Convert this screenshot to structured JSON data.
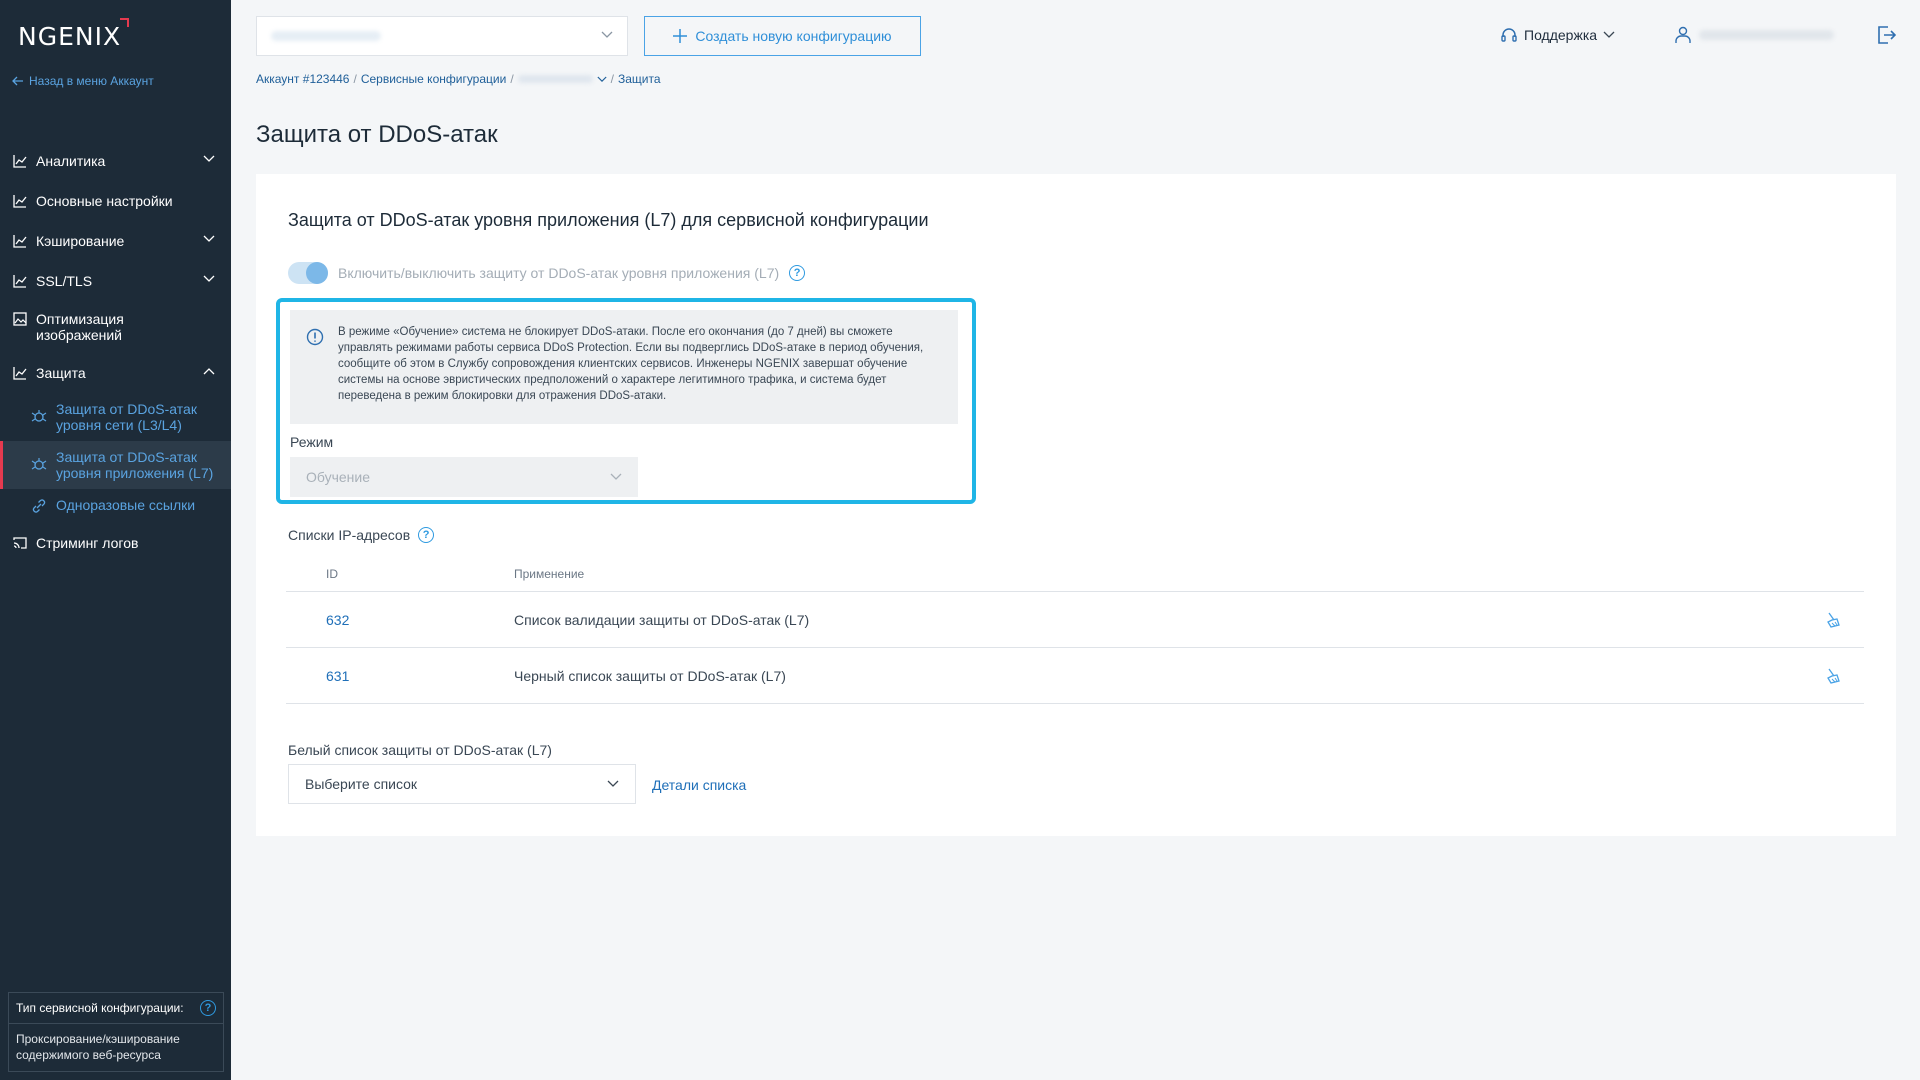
{
  "sidebar": {
    "logo": "NGENIX",
    "back_link": "Назад в меню Аккаунт",
    "items": [
      {
        "label": "Аналитика"
      },
      {
        "label": "Основные настройки"
      },
      {
        "label": "Кэширование"
      },
      {
        "label": "SSL/TLS"
      },
      {
        "label": "Оптимизация изображений"
      },
      {
        "label": "Защита"
      },
      {
        "label": "Стриминг логов"
      }
    ],
    "sub_items": [
      {
        "label": "Защита от DDoS-атак уровня сети (L3/L4)"
      },
      {
        "label": "Защита от DDoS-атак уровня приложения (L7)"
      },
      {
        "label": "Одноразовые ссылки"
      }
    ],
    "config_type": {
      "label": "Тип сервисной конфигурации:",
      "value": "Проксирование/кэширование содержимого веб-ресурса"
    }
  },
  "topbar": {
    "create_button": "Создать новую конфигурацию",
    "support": "Поддержка"
  },
  "breadcrumb": {
    "account": "Аккаунт #123446",
    "configs": "Сервисные конфигурации",
    "current": "Защита"
  },
  "page": {
    "title": "Защита от DDoS-атак"
  },
  "card": {
    "title": "Защита от DDoS-атак уровня приложения (L7) для сервисной конфигурации",
    "toggle_label": "Включить/выключить защиту от DDoS-атак уровня приложения (L7)",
    "info_text": "В режиме «Обучение» система не блокирует DDoS-атаки. После его окончания (до 7 дней) вы сможете управлять режимами работы сервиса DDoS Protection. Если вы подверглись DDoS-атаке в период обучения, сообщите об этом в Службу сопровождения клиентских сервисов. Инженеры NGENIX завершат обучение системы на основе эвристических предположений о характере легитимного трафика, и система будет переведена в режим блокировки для отражения DDoS-атаки.",
    "mode_label": "Режим",
    "mode_value": "Обучение",
    "ip_lists_label": "Списки IP-адресов",
    "table": {
      "headers": [
        "ID",
        "Применение"
      ],
      "rows": [
        {
          "id": "632",
          "application": "Список валидации защиты от DDoS-атак (L7)"
        },
        {
          "id": "631",
          "application": "Черный список защиты от DDoS-атак (L7)"
        }
      ]
    },
    "whitelist_label": "Белый список защиты от DDoS-атак (L7)",
    "whitelist_placeholder": "Выберите список",
    "details_link": "Детали списка"
  },
  "colors": {
    "sidebar_bg": "#1d2b38",
    "accent": "#2f8fd8",
    "active_marker": "#e53a4f",
    "highlight_border": "#1fb5e6"
  }
}
